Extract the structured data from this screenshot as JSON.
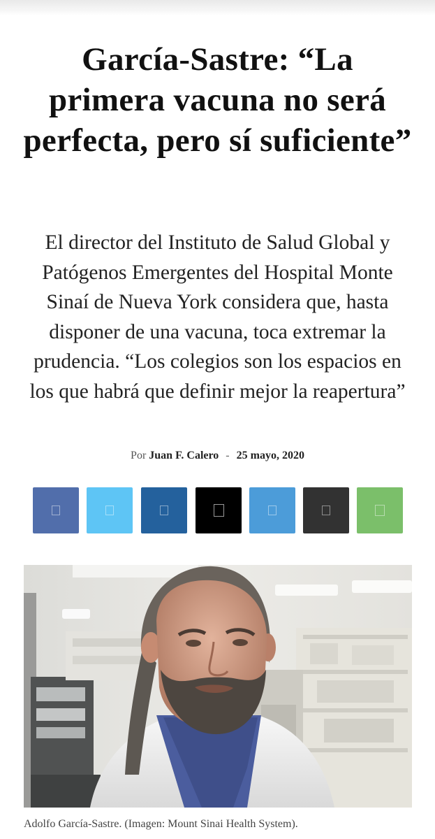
{
  "article": {
    "title": "García-Sastre: “La primera vacuna no será perfecta, pero sí suficiente”",
    "subtitle": "El director del Instituto de Salud Global y Patógenos Emergentes del Hospital Monte Sinaí de Nueva York considera que, hasta disponer de una vacuna, toca extremar la prudencia. “Los colegios son los espacios en los que habrá que definir mejor la reapertura”",
    "byline": {
      "prefix": "Por",
      "author": "Juan F. Calero",
      "separator": "-",
      "date": "25 mayo, 2020"
    },
    "image_caption": "Adolfo García-Sastre. (Imagen: Mount Sinai Health System)."
  },
  "share_buttons": [
    {
      "network": "facebook",
      "icon": "facebook-icon",
      "color": "#516eab"
    },
    {
      "network": "twitter",
      "icon": "twitter-icon",
      "color": "#5ec5f5"
    },
    {
      "network": "linkedin",
      "icon": "linkedin-icon",
      "color": "#24619d"
    },
    {
      "network": "x",
      "icon": "x-icon",
      "color": "#000000"
    },
    {
      "network": "telegram",
      "icon": "telegram-icon",
      "color": "#4c9cd9"
    },
    {
      "network": "email",
      "icon": "email-icon",
      "color": "#323232"
    },
    {
      "network": "whatsapp",
      "icon": "whatsapp-icon",
      "color": "#7bbf6a"
    }
  ]
}
